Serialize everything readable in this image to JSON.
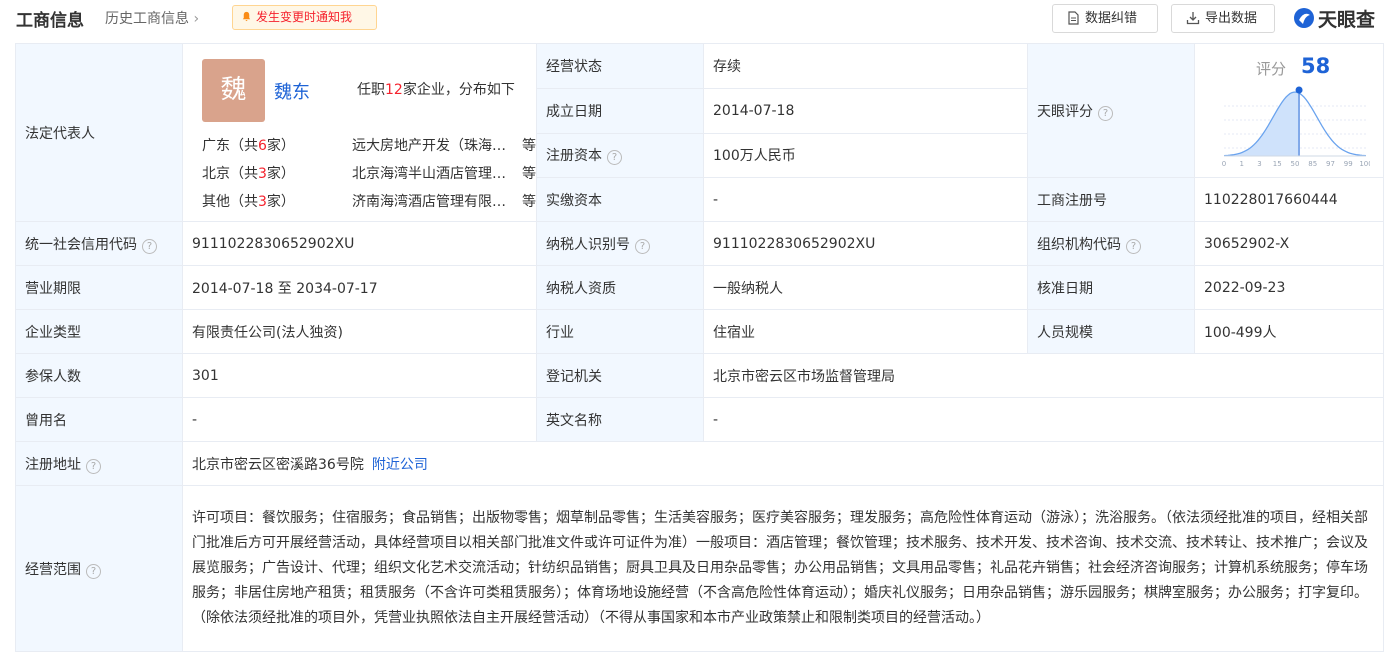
{
  "header": {
    "title": "工商信息",
    "history": "历史工商信息",
    "notify": "发生变更时通知我",
    "fix_btn": "数据纠错",
    "export_btn": "导出数据",
    "brand": "天眼查"
  },
  "rep": {
    "label": "法定代表人",
    "avatar_char": "魏",
    "name": "魏东",
    "pos_pre": "任职",
    "pos_count": "12",
    "pos_post": "家企业，分布如下",
    "rows": [
      {
        "region": "广东",
        "count": "6",
        "company": "远大房地产开发（珠海）有限公司",
        "etc": "等"
      },
      {
        "region": "北京",
        "count": "3",
        "company": "北京海湾半山酒店管理有限公司",
        "etc": "等"
      },
      {
        "region": "其他",
        "count": "3",
        "company": "济南海湾酒店管理有限公司",
        "etc": "等"
      }
    ],
    "row_pre": "（共",
    "row_post": "家）"
  },
  "fields": {
    "status_lbl": "经营状态",
    "status": "存续",
    "found_lbl": "成立日期",
    "found": "2014-07-18",
    "capital_lbl": "注册资本",
    "capital": "100万人民币",
    "paid_lbl": "实缴资本",
    "paid": "-",
    "score_lbl": "天眼评分",
    "regno_lbl": "工商注册号",
    "regno": "110228017660444",
    "credit_lbl": "统一社会信用代码",
    "credit": "9111022830652902XU",
    "taxid_lbl": "纳税人识别号",
    "taxid": "9111022830652902XU",
    "org_lbl": "组织机构代码",
    "org": "30652902-X",
    "term_lbl": "营业期限",
    "term": "2014-07-18 至 2034-07-17",
    "taxq_lbl": "纳税人资质",
    "taxq": "一般纳税人",
    "approve_lbl": "核准日期",
    "approve": "2022-09-23",
    "type_lbl": "企业类型",
    "type": "有限责任公司(法人独资)",
    "industry_lbl": "行业",
    "industry": "住宿业",
    "staff_lbl": "人员规模",
    "staff": "100-499人",
    "insured_lbl": "参保人数",
    "insured": "301",
    "authority_lbl": "登记机关",
    "authority": "北京市密云区市场监督管理局",
    "former_lbl": "曾用名",
    "former": "-",
    "en_lbl": "英文名称",
    "en": "-",
    "addr_lbl": "注册地址",
    "addr": "北京市密云区密溪路36号院",
    "nearby": "附近公司",
    "scope_lbl": "经营范围",
    "scope": "许可项目：餐饮服务；住宿服务；食品销售；出版物零售；烟草制品零售；生活美容服务；医疗美容服务；理发服务；高危险性体育运动（游泳）；洗浴服务。（依法须经批准的项目，经相关部门批准后方可开展经营活动，具体经营项目以相关部门批准文件或许可证件为准）一般项目：酒店管理；餐饮管理；技术服务、技术开发、技术咨询、技术交流、技术转让、技术推广；会议及展览服务；广告设计、代理；组织文化艺术交流活动；针纺织品销售；厨具卫具及日用杂品零售；办公用品销售；文具用品零售；礼品花卉销售；社会经济咨询服务；计算机系统服务；停车场服务；非居住房地产租赁；租赁服务（不含许可类租赁服务）；体育场地设施经营（不含高危险性体育运动）；婚庆礼仪服务；日用杂品销售；游乐园服务；棋牌室服务；办公服务；打字复印。（除依法须经批准的项目外，凭营业执照依法自主开展经营活动）（不得从事国家和本市产业政策禁止和限制类项目的经营活动。）"
  },
  "score": {
    "label": "评分",
    "value": "58",
    "axis": [
      "0",
      "1",
      "3",
      "15",
      "50",
      "85",
      "97",
      "99",
      "100"
    ],
    "marker": 58
  },
  "colors": {
    "accent": "#1e63d6",
    "label_bg": "#f2f8ff",
    "red": "#f5222d"
  }
}
